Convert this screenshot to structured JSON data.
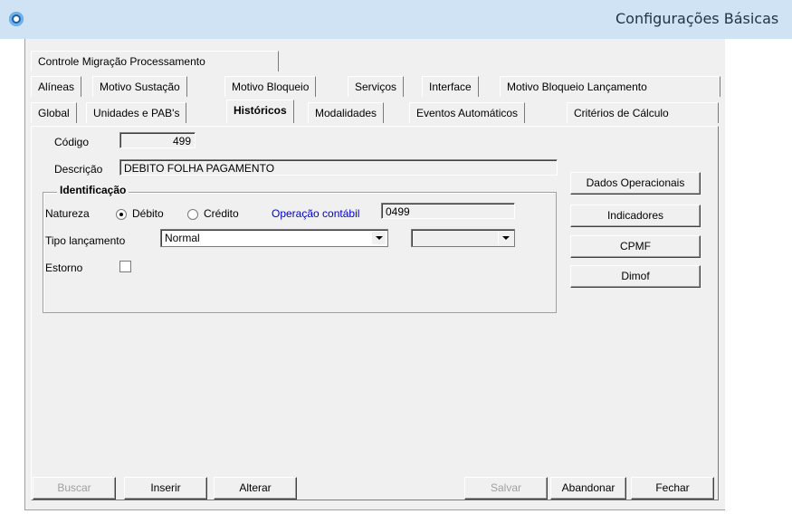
{
  "window": {
    "title": "Configurações Básicas"
  },
  "tabs": {
    "row1": [
      "Controle Migração Processamento"
    ],
    "row2": [
      "Alíneas",
      "Motivo Sustação",
      "Motivo Bloqueio",
      "Serviços",
      "Interface",
      "Motivo Bloqueio Lançamento"
    ],
    "row3": [
      "Global",
      "Unidades e PAB's",
      "Históricos",
      "Modalidades",
      "Eventos Automáticos",
      "Critérios de Cálculo"
    ],
    "active": "Históricos"
  },
  "form": {
    "codigo_label": "Código",
    "codigo_value": "499",
    "descricao_label": "Descrição",
    "descricao_value": "DEBITO FOLHA PAGAMENTO",
    "group_title": "Identificação",
    "natureza_label": "Natureza",
    "debito_label": "Débito",
    "credito_label": "Crédito",
    "natureza_selected": "Débito",
    "operacao_label": "Operação contábil",
    "operacao_value": "0499",
    "tipo_label": "Tipo lançamento",
    "tipo_value": "Normal",
    "tipo2_value": "",
    "estorno_label": "Estorno",
    "estorno_checked": false
  },
  "side_buttons": {
    "dados": "Dados Operacionais",
    "indicadores": "Indicadores",
    "cpmf": "CPMF",
    "dimof": "Dimof"
  },
  "bottom_buttons": {
    "buscar": "Buscar",
    "inserir": "Inserir",
    "alterar": "Alterar",
    "salvar": "Salvar",
    "abandonar": "Abandonar",
    "fechar": "Fechar"
  }
}
